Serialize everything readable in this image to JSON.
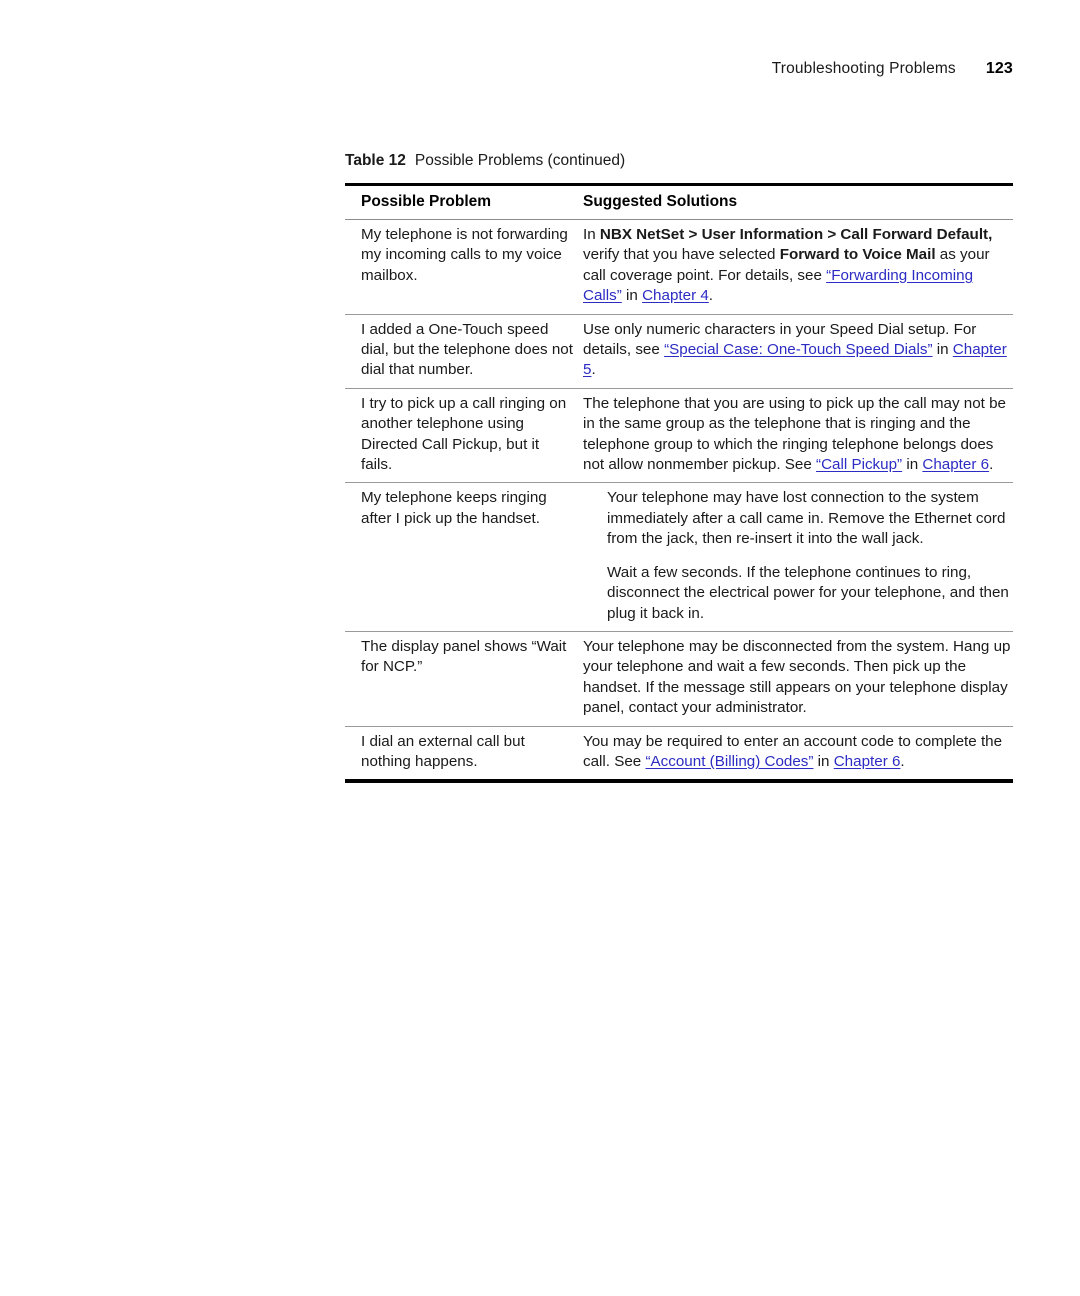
{
  "page": {
    "running_head_title": "Troubleshooting Problems",
    "page_number": "123",
    "link_color": "#2c2cc4",
    "rule_color": "#000000"
  },
  "table": {
    "caption_label": "Table 12",
    "caption_text": "Possible Problems (continued)",
    "columns": [
      {
        "header": "Possible Problem"
      },
      {
        "header": "Suggested Solutions"
      }
    ],
    "rows": [
      {
        "problem": "My telephone is not forwarding my incoming calls to my voice mailbox.",
        "solution_runs": [
          {
            "text": "In ",
            "style": "normal"
          },
          {
            "text": "NBX NetSet > User Information > Call Forward Default,",
            "style": "bold"
          },
          {
            "text": " verify that you have selected ",
            "style": "normal"
          },
          {
            "text": "Forward to Voice Mail",
            "style": "bold"
          },
          {
            "text": " as your call coverage point. For details, see ",
            "style": "normal"
          },
          {
            "text": "“Forwarding Incoming Calls”",
            "style": "link"
          },
          {
            "text": " in ",
            "style": "normal"
          },
          {
            "text": "Chapter 4",
            "style": "link"
          },
          {
            "text": ".",
            "style": "normal"
          }
        ]
      },
      {
        "problem": "I added a One-Touch speed dial, but the telephone does not dial that number.",
        "solution_runs": [
          {
            "text": "Use only numeric characters in your Speed Dial setup. For details, see ",
            "style": "normal"
          },
          {
            "text": "“Special Case: One-Touch Speed Dials”",
            "style": "link"
          },
          {
            "text": " in ",
            "style": "normal"
          },
          {
            "text": "Chapter 5",
            "style": "link"
          },
          {
            "text": ".",
            "style": "normal"
          }
        ]
      },
      {
        "problem": "I try to pick up a call ringing on another telephone using Directed Call Pickup, but it fails.",
        "solution_runs": [
          {
            "text": "The telephone that you are using to pick up the call may not be in the same group as the telephone that is ringing and the telephone group to which the ringing telephone belongs does not allow nonmember pickup. See ",
            "style": "normal"
          },
          {
            "text": "“Call Pickup”",
            "style": "link"
          },
          {
            "text": " in ",
            "style": "normal"
          },
          {
            "text": "Chapter 6",
            "style": "link"
          },
          {
            "text": ".",
            "style": "normal"
          }
        ]
      },
      {
        "problem": "My telephone keeps ringing after I pick up the handset.",
        "indented": true,
        "solution_paragraphs": [
          [
            {
              "text": "Your telephone may have lost connection to the system immediately after a call came in. Remove the Ethernet cord from the jack, then re-insert it into the wall jack.",
              "style": "normal"
            }
          ],
          [
            {
              "text": "Wait a few seconds. If the telephone continues to ring, disconnect the electrical power for your telephone, and then plug it back in.",
              "style": "normal"
            }
          ]
        ]
      },
      {
        "problem": "The display panel shows “Wait for NCP.”",
        "solution_runs": [
          {
            "text": "Your telephone may be disconnected from the system. Hang up your telephone and wait a few seconds. Then pick up the handset. If the message still appears on your telephone display panel, contact your administrator.",
            "style": "normal"
          }
        ]
      },
      {
        "problem": "I dial an external call but nothing happens.",
        "solution_runs": [
          {
            "text": "You may be required to enter an account code to complete the call. See ",
            "style": "normal"
          },
          {
            "text": "“Account (Billing) Codes”",
            "style": "link"
          },
          {
            "text": " in ",
            "style": "normal"
          },
          {
            "text": "Chapter 6",
            "style": "link"
          },
          {
            "text": ".",
            "style": "normal"
          }
        ]
      }
    ]
  }
}
